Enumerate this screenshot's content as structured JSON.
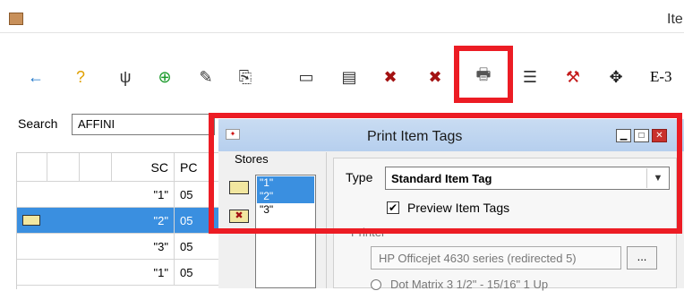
{
  "window": {
    "title": "Ite"
  },
  "toolbar": {
    "buttons": [
      {
        "icon": "back-arrow-icon",
        "glyph": "←",
        "color": "#1a73c8"
      },
      {
        "icon": "help-icon",
        "glyph": "?",
        "color": "#e0a000"
      },
      {
        "icon": "fork-icon",
        "glyph": "ψ",
        "color": "#333"
      },
      {
        "icon": "add-item-icon",
        "glyph": "⊕",
        "color": "#1a9a2a"
      },
      {
        "icon": "edit-item-icon",
        "glyph": "✎",
        "color": "#333"
      },
      {
        "icon": "copy-item-icon",
        "glyph": "⎘",
        "color": "#333"
      },
      {
        "icon": "tag-icon",
        "glyph": "▭",
        "color": "#333"
      },
      {
        "icon": "tags-icon",
        "glyph": "▤",
        "color": "#333"
      },
      {
        "icon": "delete-tag-icon",
        "glyph": "✖",
        "color": "#a31111"
      },
      {
        "icon": "delete-tags-icon",
        "glyph": "✖",
        "color": "#a31111"
      },
      {
        "icon": "print-icon",
        "glyph": "🖶",
        "color": "#555"
      },
      {
        "icon": "list-icon",
        "glyph": "☰",
        "color": "#333"
      },
      {
        "icon": "tools-icon",
        "glyph": "⚒",
        "color": "#c41a1a"
      },
      {
        "icon": "move-icon",
        "glyph": "✥",
        "color": "#222"
      }
    ],
    "e3_label": "E-3"
  },
  "search": {
    "label": "Search",
    "value": "AFFINI"
  },
  "grid": {
    "headers": [
      "",
      "",
      "",
      "SC",
      "PC"
    ],
    "rows": [
      {
        "sc": "\"1\"",
        "pc": "05",
        "selected": false
      },
      {
        "sc": "\"2\"",
        "pc": "05",
        "selected": true
      },
      {
        "sc": "\"3\"",
        "pc": "05",
        "selected": false
      },
      {
        "sc": "\"1\"",
        "pc": "05",
        "selected": false
      }
    ]
  },
  "dialog": {
    "title": "Print Item Tags",
    "stores_label": "Stores",
    "stores": [
      {
        "label": "\"1\"",
        "selected": true
      },
      {
        "label": "\"2\"",
        "selected": true
      },
      {
        "label": "\"3\"",
        "selected": false
      }
    ],
    "type_label": "Type",
    "type_value": "Standard Item Tag",
    "preview_label": "Preview Item Tags",
    "preview_checked": true,
    "printer_label": "Printer",
    "printer_value": "HP Officejet 4630 series (redirected 5)",
    "browse_label": "...",
    "radio_label": "Dot Matrix 3 1/2\" - 15/16\" 1 Up",
    "minimize_glyph": "▁",
    "maximize_glyph": "□",
    "close_glyph": "✕"
  },
  "colors": {
    "selection": "#3a8fe0",
    "highlight": "#ec1c24"
  }
}
